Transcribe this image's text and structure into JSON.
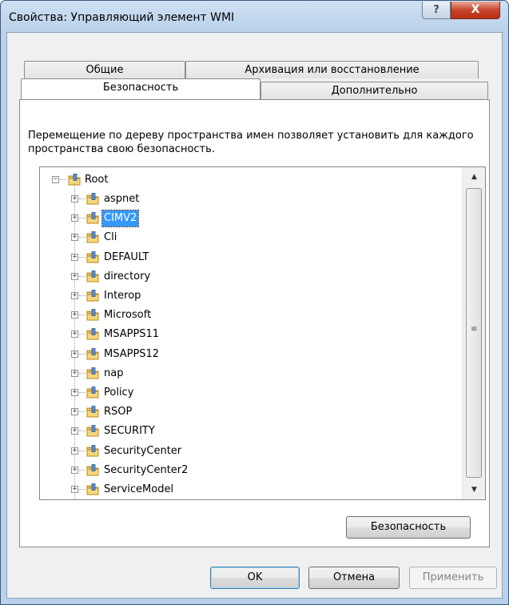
{
  "window": {
    "title": "Свойства: Управляющий элемент WMI",
    "help_glyph": "?",
    "close_glyph": "X"
  },
  "tabs": {
    "row_back": [
      "Общие",
      "Архивация или восстановление"
    ],
    "row_front": [
      "Безопасность",
      "Дополнительно"
    ],
    "active": "Безопасность"
  },
  "description": "Перемещение по дереву пространства имен позволяет установить для каждого пространства свою безопасность.",
  "tree": {
    "root": {
      "label": "Root",
      "expander": "−"
    },
    "children": [
      {
        "label": "aspnet"
      },
      {
        "label": "CIMV2",
        "selected": true
      },
      {
        "label": "Cli"
      },
      {
        "label": "DEFAULT"
      },
      {
        "label": "directory"
      },
      {
        "label": "Interop"
      },
      {
        "label": "Microsoft"
      },
      {
        "label": "MSAPPS11"
      },
      {
        "label": "MSAPPS12"
      },
      {
        "label": "nap"
      },
      {
        "label": "Policy"
      },
      {
        "label": "RSOP"
      },
      {
        "label": "SECURITY"
      },
      {
        "label": "SecurityCenter"
      },
      {
        "label": "SecurityCenter2"
      },
      {
        "label": "ServiceModel"
      }
    ],
    "child_expander": "+"
  },
  "scrollbar": {
    "up_glyph": "▲",
    "down_glyph": "▼",
    "grip_glyph": "≡"
  },
  "buttons": {
    "security": "Безопасность",
    "ok": "OK",
    "cancel": "Отмена",
    "apply": "Применить"
  },
  "colors": {
    "selection": "#3399ff",
    "close_button": "#c9452c"
  }
}
